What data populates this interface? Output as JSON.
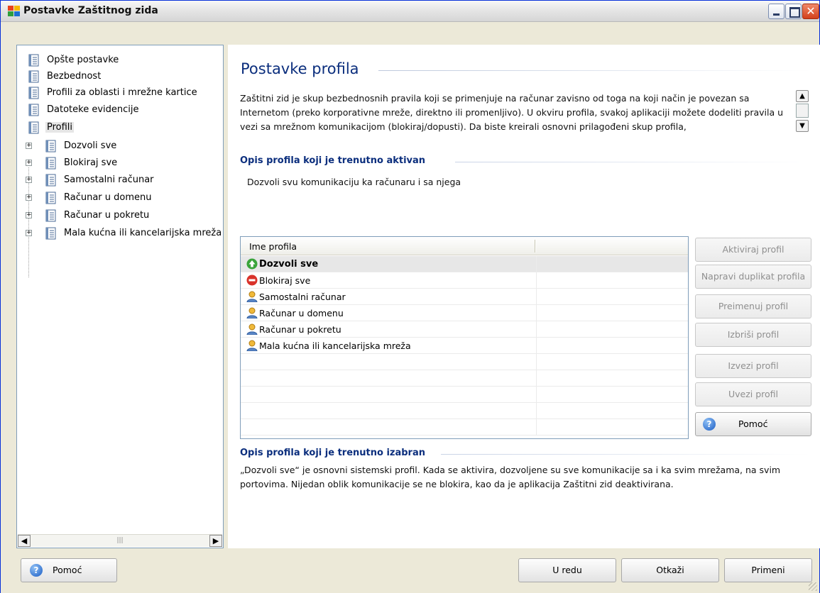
{
  "window": {
    "title": "Postavke Zaštitnog zida"
  },
  "tree": {
    "items": [
      {
        "label": "Opšte postavke"
      },
      {
        "label": "Bezbednost"
      },
      {
        "label": "Profili za oblasti i mrežne kartice"
      },
      {
        "label": "Datoteke evidencije"
      },
      {
        "label": "Profili"
      },
      {
        "label": "Dozvoli sve"
      },
      {
        "label": "Blokiraj sve"
      },
      {
        "label": "Samostalni računar"
      },
      {
        "label": "Računar u domenu"
      },
      {
        "label": "Računar u pokretu"
      },
      {
        "label": "Mala kućna ili kancelarijska mreža"
      }
    ]
  },
  "main": {
    "title": "Postavke profila",
    "intro": "Zaštitni zid je skup bezbednosnih pravila koji se primenjuje na računar zavisno od toga na koji način je povezan sa Internetom (preko korporativne mreže, direktno ili promenljivo). U okviru profila, svakoj aplikaciji možete dodeliti pravila u vezi sa mrežnom komunikacijom (blokiraj/dopusti). Da biste kreirali osnovni prilagođeni skup profila,",
    "active_heading": "Opis profila koji je trenutno aktivan",
    "active_desc": "Dozvoli svu komunikaciju ka računaru i sa njega",
    "table": {
      "col_header": "Ime profila",
      "rows": [
        {
          "label": "Dozvoli sve",
          "icon": "allow-icon",
          "selected": true
        },
        {
          "label": "Blokiraj sve",
          "icon": "block-icon",
          "selected": false
        },
        {
          "label": "Samostalni računar",
          "icon": "user-icon",
          "selected": false
        },
        {
          "label": "Računar u domenu",
          "icon": "user-icon",
          "selected": false
        },
        {
          "label": "Računar u pokretu",
          "icon": "user-icon",
          "selected": false
        },
        {
          "label": "Mala kućna ili kancelarijska mreža",
          "icon": "user-icon",
          "selected": false
        }
      ]
    },
    "buttons": {
      "activate": "Aktiviraj profil",
      "duplicate": "Napravi duplikat profila",
      "rename": "Preimenuj profil",
      "delete": "Izbriši profil",
      "export": "Izvezi profil",
      "import": "Uvezi profil",
      "help": "Pomoć"
    },
    "selected_heading": "Opis profila koji je trenutno izabran",
    "selected_desc": "„Dozvoli sve“ je osnovni sistemski profil. Kada se aktivira, dozvoljene su sve komunikacije sa i ka svim mrežama, na svim portovima. Nijedan oblik komunikacije se ne blokira, kao da je aplikacija Zaštitni zid deaktivirana."
  },
  "footer": {
    "help": "Pomoć",
    "ok": "U redu",
    "cancel": "Otkaži",
    "apply": "Primeni"
  },
  "colors": {
    "heading": "#0b2e7d",
    "allow": "#3aa43a",
    "block": "#d9322a",
    "user": "#e0a020"
  }
}
